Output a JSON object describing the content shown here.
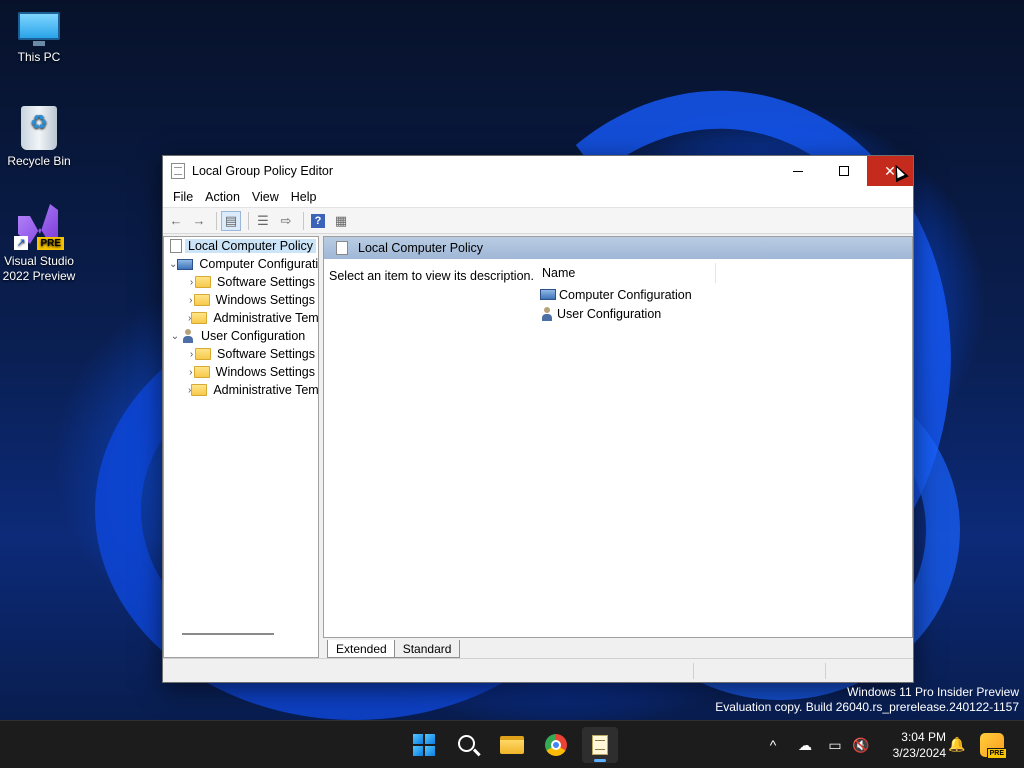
{
  "desktop": {
    "icons": [
      {
        "label": "This PC",
        "icon": "monitor-icon"
      },
      {
        "label": "Recycle Bin",
        "icon": "recycle-bin-icon"
      },
      {
        "label_line1": "Visual Studio",
        "label_line2": "2022 Preview",
        "badge": "PRE",
        "icon": "visual-studio-icon"
      }
    ],
    "watermark": {
      "line1": "Windows 11 Pro Insider Preview",
      "line2": "Evaluation copy. Build 26040.rs_prerelease.240122-1157"
    }
  },
  "window": {
    "title": "Local Group Policy Editor",
    "controls": {
      "minimize": "minimize-icon",
      "maximize": "maximize-icon",
      "close": "✕"
    },
    "menu": [
      "File",
      "Action",
      "View",
      "Help"
    ],
    "toolbar": {
      "back": "←",
      "forward": "→",
      "show_hide_tree": "▤",
      "properties": "☰",
      "export": "⇨",
      "help": "?",
      "show_hide_action": "▦"
    },
    "tree": {
      "root": "Local Computer Policy",
      "nodes": [
        {
          "label": "Computer Configuration",
          "expanded": true,
          "children": [
            "Software Settings",
            "Windows Settings",
            "Administrative Templates"
          ]
        },
        {
          "label": "User Configuration",
          "expanded": true,
          "children": [
            "Software Settings",
            "Windows Settings",
            "Administrative Templates"
          ]
        }
      ]
    },
    "details": {
      "header": "Local Computer Policy",
      "description": "Select an item to view its description.",
      "column_name": "Name",
      "items": [
        "Computer Configuration",
        "User Configuration"
      ]
    },
    "tabs": [
      "Extended",
      "Standard"
    ],
    "active_tab": "Extended"
  },
  "taskbar": {
    "apps": [
      "start-icon",
      "search-icon",
      "file-explorer-icon",
      "chrome-icon",
      "group-policy-editor-icon"
    ],
    "active_app": "group-policy-editor-icon",
    "tray": {
      "chevron": "^",
      "onedrive": "☁",
      "network": "▭",
      "volume": "🔇"
    },
    "time": "3:04 PM",
    "date": "3/23/2024",
    "copilot_badge": "PRE"
  }
}
